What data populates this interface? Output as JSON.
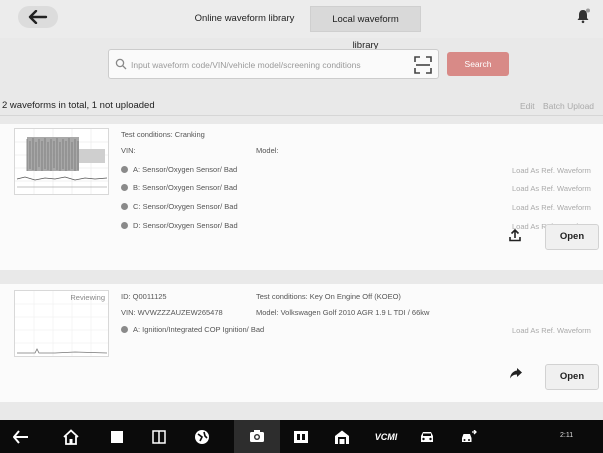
{
  "header": {
    "tabs": [
      {
        "label": "Online waveform library",
        "active": false
      },
      {
        "label": "Local waveform library",
        "active": true
      }
    ]
  },
  "search": {
    "placeholder": "Input waveform code/VIN/vehicle model/screening conditions",
    "button_label": "Search",
    "button_color": "#d88a87"
  },
  "summary": {
    "count_text": "2 waveforms in total, 1 not uploaded",
    "edit_label": "Edit",
    "batch_upload_label": "Batch Upload"
  },
  "waveforms": [
    {
      "test_conditions": "Test conditions: Cranking",
      "vin": "VIN:",
      "model": "Model:",
      "channels": [
        {
          "label": "A: Sensor/Oxygen Sensor/ Bad",
          "ref": "Load As Ref. Waveform"
        },
        {
          "label": "B: Sensor/Oxygen Sensor/ Bad",
          "ref": "Load As Ref. Waveform"
        },
        {
          "label": "C: Sensor/Oxygen Sensor/ Bad",
          "ref": "Load As Ref. Waveform"
        },
        {
          "label": "D: Sensor/Oxygen Sensor/ Bad",
          "ref": "Load As Ref. Waveform"
        }
      ],
      "open_label": "Open"
    },
    {
      "badge": "Reviewing",
      "id": "ID: Q0011125",
      "test_conditions": "Test conditions: Key On Engine Off (KOEO)",
      "vin": "VIN: WVWZZZAUZEW265478",
      "model": "Model: Volkswagen Golf 2010 AGR 1.9 L TDI / 66kw",
      "channels": [
        {
          "label": "A: Ignition/Integrated COP Ignition/ Bad",
          "ref": "Load As Ref. Waveform"
        }
      ],
      "open_label": "Open"
    }
  ],
  "navbar": {
    "vcm_label": "VCMI",
    "status_text": "2:11"
  },
  "icons": [
    "back-arrow-icon",
    "bell-icon",
    "search-icon",
    "scan-icon",
    "upload-icon",
    "share-icon",
    "home-icon",
    "recent-apps-icon",
    "camera-icon"
  ]
}
